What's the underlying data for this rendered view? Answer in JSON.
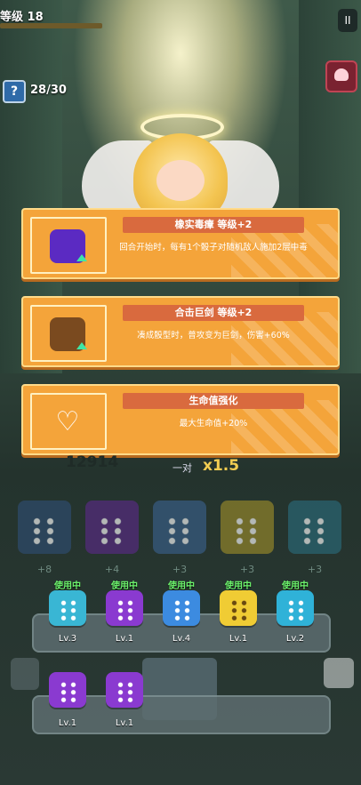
{
  "header": {
    "level_text": "等级 18",
    "pause_label": "II",
    "help_label": "?",
    "wave": "28/30"
  },
  "cards": [
    {
      "title": "橡实毒瘴 等级+2",
      "desc": "回合开始时，每有1个骰子对随机敌人施加2层中毒",
      "icon": "poison-acorn-icon",
      "color": "#5b2ac2"
    },
    {
      "title": "合击巨剑 等级+2",
      "desc": "凑成骰型时，普攻变为巨剑，伤害+60%",
      "icon": "giant-sword-icon",
      "color": "#7a4a1f"
    },
    {
      "title": "生命值强化",
      "desc": "最大生命值+20%",
      "icon": "heart-icon",
      "color": "#f4a43a"
    }
  ],
  "score": "12914",
  "combo": {
    "label": "一对",
    "mult": "x1.5"
  },
  "big_dice_bonus": [
    "+8",
    "+4",
    "+3",
    "+3",
    "+3"
  ],
  "active_dice": [
    {
      "status": "使用中",
      "level": "Lv.3",
      "color": "#39b6d4"
    },
    {
      "status": "使用中",
      "level": "Lv.1",
      "color": "#8a3ad0"
    },
    {
      "status": "使用中",
      "level": "Lv.4",
      "color": "#3c8be0"
    },
    {
      "status": "使用中",
      "level": "Lv.1",
      "color": "#f0cc34"
    },
    {
      "status": "使用中",
      "level": "Lv.2",
      "color": "#2fb2d8"
    }
  ],
  "reserve_dice": [
    {
      "level": "Lv.1",
      "color": "#8a3ad0"
    },
    {
      "level": "Lv.1",
      "color": "#8a3ad0"
    }
  ]
}
